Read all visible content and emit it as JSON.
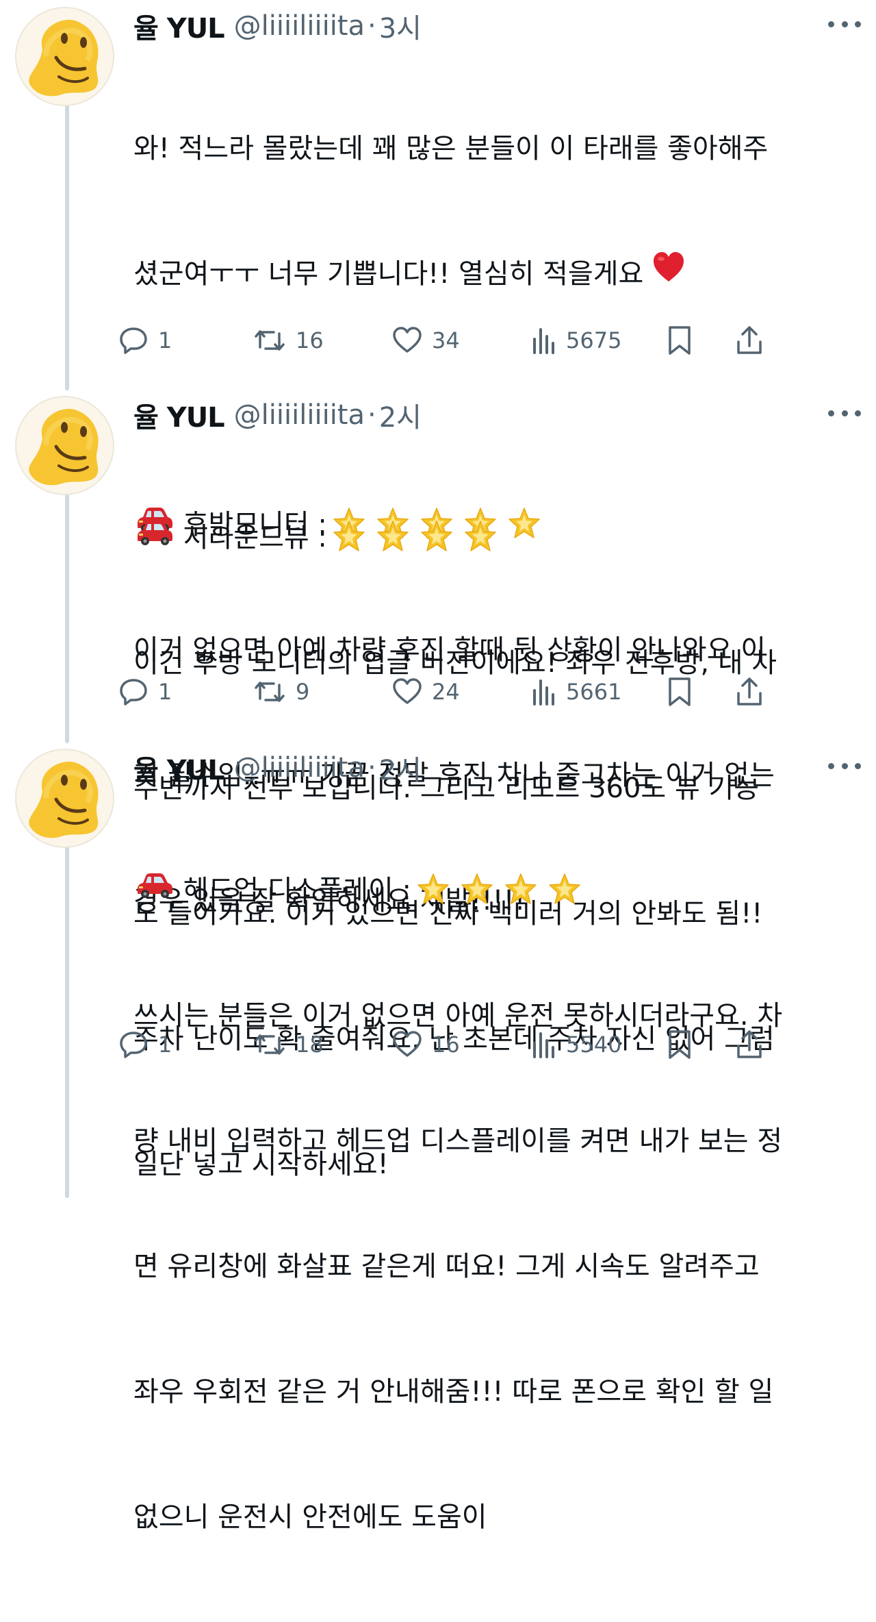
{
  "user": {
    "name": "율 YUL",
    "handle": "@liiiiliiiita",
    "avatar_icon": "melting-face-icon"
  },
  "tweets": [
    {
      "time": "3시",
      "lines": [
        "와! 적느라 몰랐는데 꽤 많은 분들이 이 타래를 좋아해주",
        "셨군여ㅜㅜ 너무 기쁩니다!! 열심히 적을게요",
        "",
        "후방모니터 :",
        "이거 없으면 아예 차량 후진 할때 뒷 상황이 안나와요 이",
        "거 필수임..ㅠㅠ 가끔 정말 후진 차나 중고차는 이거 없는",
        "경우 있음 잘 확인하세요 제발!!!!!"
      ],
      "rating": 5,
      "stats": {
        "replies": "1",
        "reposts": "16",
        "likes": "34",
        "views": "5675"
      }
    },
    {
      "time": "2시",
      "lines": [
        "서라운드뷰 :",
        "이건 후방 모니터의 업글 버전이에요! 좌우 전후방, 내 차",
        "주변까지 전부 보입니다. 그리고 리모트 360도 뷰 기능",
        "도 들어가요. 이거 있으면 진짜 백미러 거의 안봐도 됨!!",
        "주차 난이도 확 줄여줘요. 난 초본데 주차 자신 없어 그럼",
        "일단 넣고 시작하세요!"
      ],
      "rating": 4,
      "stats": {
        "replies": "1",
        "reposts": "9",
        "likes": "24",
        "views": "5661"
      }
    },
    {
      "time": "2시",
      "lines": [
        "헤드업 디스플레이 :",
        "쓰시는 분들은 이거 없으면 아예 운전 못하시더라구요. 차",
        "량 내비 입력하고 헤드업 디스플레이를 켜면 내가 보는 정",
        "면 유리창에 화살표 같은게 떠요! 그게 시속도 알려주고",
        "좌우 우회전 같은 거 안내해줌!!! 따로 폰으로 확인 할 일",
        "없으니 운전시 안전에도 도움이"
      ],
      "rating": 4,
      "stats": {
        "replies": "1",
        "reposts": "18",
        "likes": "16",
        "views": "5540"
      }
    }
  ],
  "icons": [
    "reply-icon",
    "repost-icon",
    "like-icon",
    "views-icon",
    "bookmark-icon",
    "share-icon",
    "more-icon",
    "car-icon",
    "star-icon",
    "heart-icon"
  ],
  "colors": {
    "text": "#0f1419",
    "secondary": "#536471",
    "thread_line": "#cfd9de",
    "heart": "#e0202e",
    "car": "#d8262d",
    "star": "#f6c426"
  }
}
